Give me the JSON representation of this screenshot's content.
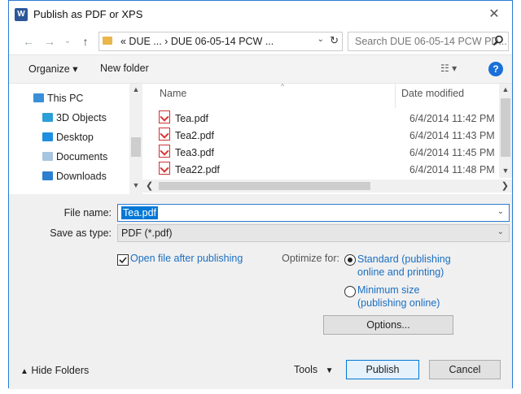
{
  "window": {
    "title": "Publish as PDF or XPS",
    "app_icon": "W",
    "close": "✕"
  },
  "nav": {
    "address": "« DUE ... › DUE 06-05-14 PCW ...",
    "search_placeholder": "Search DUE 06-05-14 PCW PD..."
  },
  "toolbar": {
    "organize": "Organize ▾",
    "new_folder": "New folder",
    "help": "?"
  },
  "nav_pane": {
    "items": [
      {
        "label": "This PC",
        "icon": "pc-icon"
      },
      {
        "label": "3D Objects",
        "icon": "folder-3d-icon"
      },
      {
        "label": "Desktop",
        "icon": "desktop-folder-icon"
      },
      {
        "label": "Documents",
        "icon": "documents-folder-icon"
      },
      {
        "label": "Downloads",
        "icon": "downloads-folder-icon"
      }
    ]
  },
  "file_list": {
    "headers": {
      "name": "Name",
      "date": "Date modified"
    },
    "rows": [
      {
        "name": "Tea.pdf",
        "date": "6/4/2014 11:42 PM"
      },
      {
        "name": "Tea2.pdf",
        "date": "6/4/2014 11:43 PM"
      },
      {
        "name": "Tea3.pdf",
        "date": "6/4/2014 11:45 PM"
      },
      {
        "name": "Tea22.pdf",
        "date": "6/4/2014 11:48 PM"
      }
    ]
  },
  "form": {
    "file_name_label": "File name:",
    "file_name_value": "Tea.pdf",
    "save_type_label": "Save as type:",
    "save_type_value": "PDF (*.pdf)",
    "open_after_label": "Open file after publishing",
    "open_after_checked": true,
    "optimize_label": "Optimize for:",
    "standard_line1": "Standard (publishing",
    "standard_line2": "online and printing)",
    "minimum_line1": "Minimum size",
    "minimum_line2": "(publishing online)",
    "options_button": "Options..."
  },
  "footer": {
    "hide_folders": "Hide Folders",
    "tools": "Tools",
    "publish": "Publish",
    "cancel": "Cancel"
  },
  "colors": {
    "accent": "#0078d7",
    "link": "#1a6fc2",
    "titlebar_border": "#2b7bd6"
  }
}
